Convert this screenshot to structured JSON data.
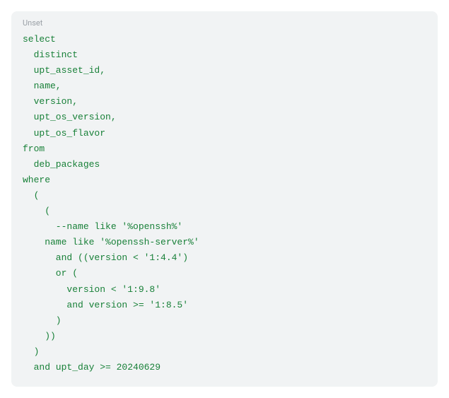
{
  "codeblock": {
    "language_label": "Unset",
    "lines": [
      "select",
      "  distinct",
      "  upt_asset_id,",
      "  name,",
      "  version,",
      "  upt_os_version,",
      "  upt_os_flavor",
      "from",
      "  deb_packages",
      "where",
      "  (",
      "    (",
      "      --name like '%openssh%'",
      "    name like '%openssh-server%'",
      "      and ((version < '1:4.4')",
      "      or (",
      "        version < '1:9.8'",
      "        and version >= '1:8.5'",
      "      )",
      "    ))",
      "  )",
      "  and upt_day >= 20240629"
    ]
  }
}
